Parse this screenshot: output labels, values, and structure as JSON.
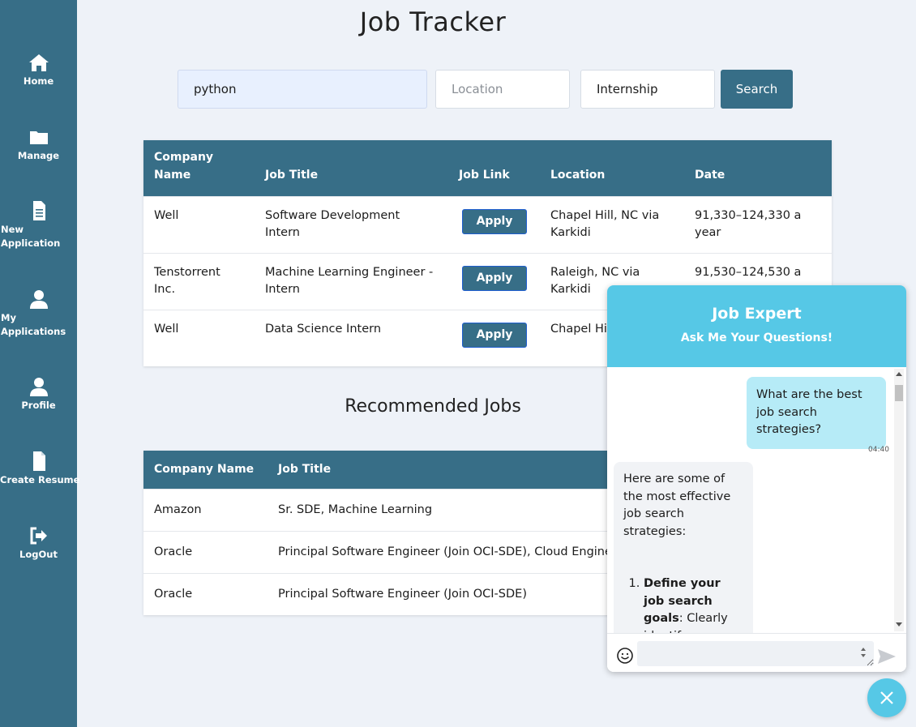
{
  "sidebar": {
    "items": [
      {
        "label": "Home",
        "icon": "home-icon"
      },
      {
        "label": "Manage",
        "icon": "folder-icon"
      },
      {
        "label": "New Application",
        "icon": "document-icon"
      },
      {
        "label": "My Applications",
        "icon": "user-icon"
      },
      {
        "label": "Profile",
        "icon": "user-icon"
      },
      {
        "label": "Create Resume",
        "icon": "file-icon"
      },
      {
        "label": "LogOut",
        "icon": "logout-icon"
      }
    ]
  },
  "page": {
    "title": "Job Tracker"
  },
  "search": {
    "keyword_value": "python",
    "location_placeholder": "Location",
    "type_value": "Internship",
    "button_label": "Search"
  },
  "jobs_table": {
    "headers": [
      "Company Name",
      "Job Title",
      "Job Link",
      "Location",
      "Date"
    ],
    "apply_label": "Apply",
    "rows": [
      {
        "company": "Well",
        "title": "Software Development Intern",
        "location": "Chapel Hill, NC via Karkidi",
        "date": "91,330–124,330 a year"
      },
      {
        "company": "Tenstorrent Inc.",
        "title": "Machine Learning Engineer - Intern",
        "location": "Raleigh, NC via Karkidi",
        "date": "91,530–124,530 a"
      },
      {
        "company": "Well",
        "title": "Data Science Intern",
        "location": "Chapel Hi Karkidi",
        "date": ""
      }
    ]
  },
  "recommended": {
    "title": "Recommended Jobs",
    "headers": [
      "Company Name",
      "Job Title"
    ],
    "rows": [
      {
        "company": "Amazon",
        "title": "Sr. SDE, Machine Learning"
      },
      {
        "company": "Oracle",
        "title": "Principal Software Engineer (Join OCI-SDE), Cloud Engine"
      },
      {
        "company": "Oracle",
        "title": "Principal Software Engineer (Join OCI-SDE)"
      }
    ]
  },
  "chat": {
    "title": "Job Expert",
    "subtitle": "Ask Me Your Questions!",
    "user_message": "What are the best job search strategies?",
    "user_time": "04:40",
    "bot_intro": "Here are some of the most effective job search strategies:",
    "bot_item_bold": "Define your job search goals",
    "bot_item_text": ": Clearly identify"
  },
  "colors": {
    "sidebar": "#376e87",
    "accent": "#56c8e6",
    "background": "#eef2f8"
  }
}
